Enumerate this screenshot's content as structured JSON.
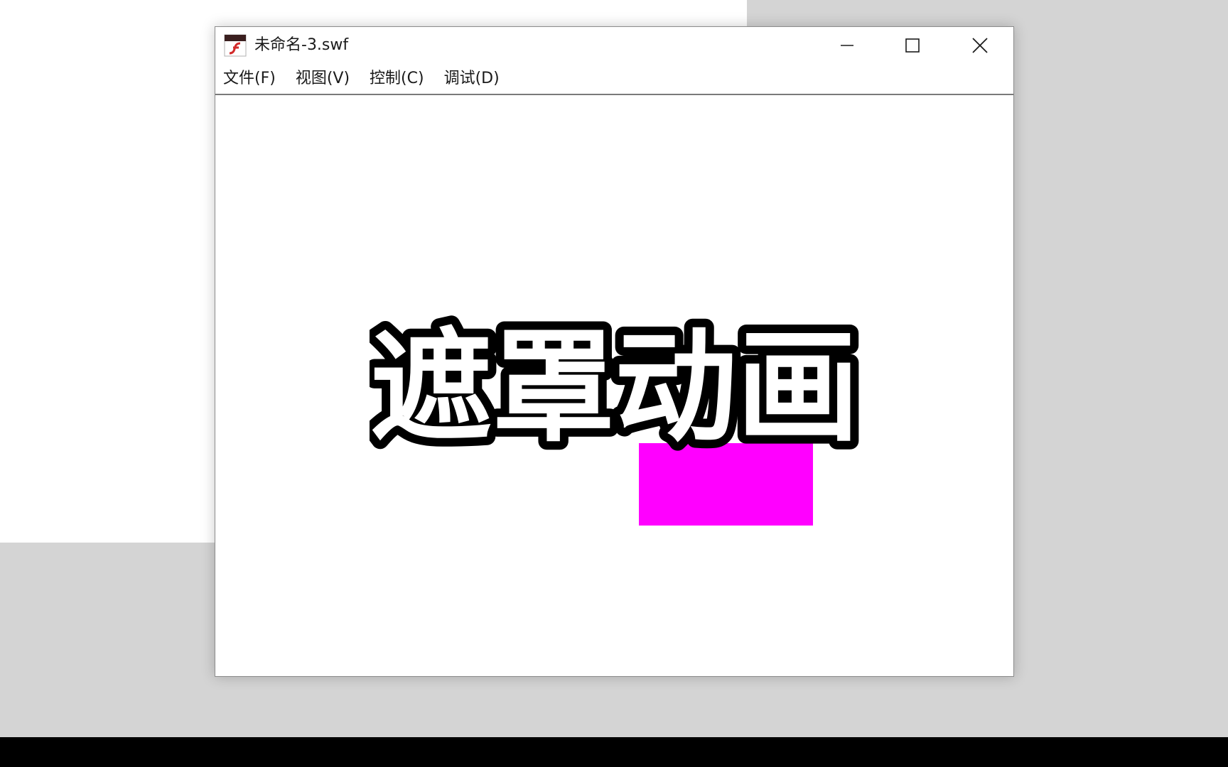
{
  "window": {
    "title": "未命名-3.swf",
    "icon": "flash-player-icon",
    "controls": {
      "minimize_icon": "minimize-icon",
      "maximize_icon": "maximize-icon",
      "close_icon": "close-icon"
    }
  },
  "menubar": {
    "items": [
      {
        "label": "文件(F)"
      },
      {
        "label": "视图(V)"
      },
      {
        "label": "控制(C)"
      },
      {
        "label": "调试(D)"
      }
    ]
  },
  "stage": {
    "shape_color": "#ff00ff"
  },
  "overlay": {
    "caption": "遮罩动画"
  }
}
